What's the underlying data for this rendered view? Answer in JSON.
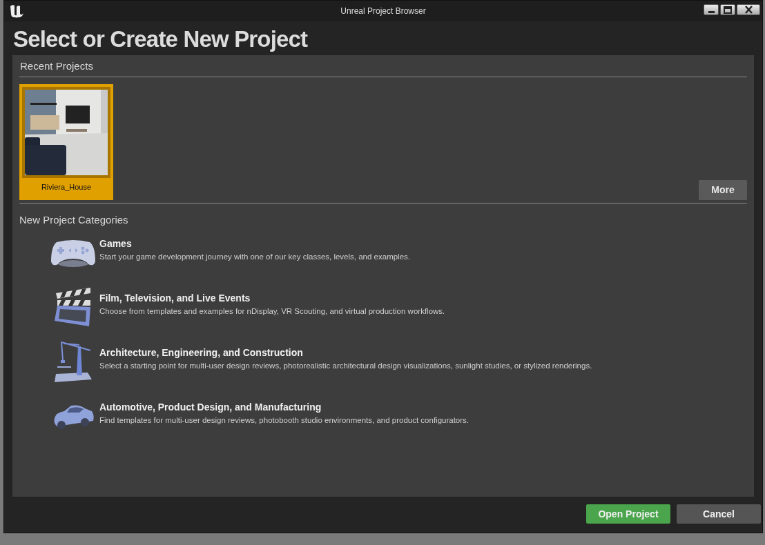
{
  "window": {
    "title": "Unreal Project Browser"
  },
  "heading": "Select or Create New Project",
  "recent_projects": {
    "title": "Recent Projects",
    "items": [
      {
        "name": "Riviera_House",
        "selected": true
      }
    ],
    "more_button": "More"
  },
  "categories": {
    "title": "New Project Categories",
    "items": [
      {
        "kind": "games",
        "title": "Games",
        "description": "Start your game development journey with one of our key classes, levels, and examples."
      },
      {
        "kind": "film",
        "title": "Film, Television, and Live Events",
        "description": "Choose from templates and examples for nDisplay, VR Scouting, and virtual production workflows."
      },
      {
        "kind": "architecture",
        "title": "Architecture, Engineering, and Construction",
        "description": "Select a starting point for multi-user design reviews, photorealistic architectural design visualizations, sunlight studies, or stylized renderings."
      },
      {
        "kind": "automotive",
        "title": "Automotive, Product Design, and Manufacturing",
        "description": "Find templates for multi-user design reviews, photobooth studio environments, and product configurators."
      }
    ]
  },
  "buttons": [
    {
      "kind": "primary",
      "label": "Open Project"
    },
    {
      "kind": "secondary",
      "label": "Cancel"
    }
  ]
}
